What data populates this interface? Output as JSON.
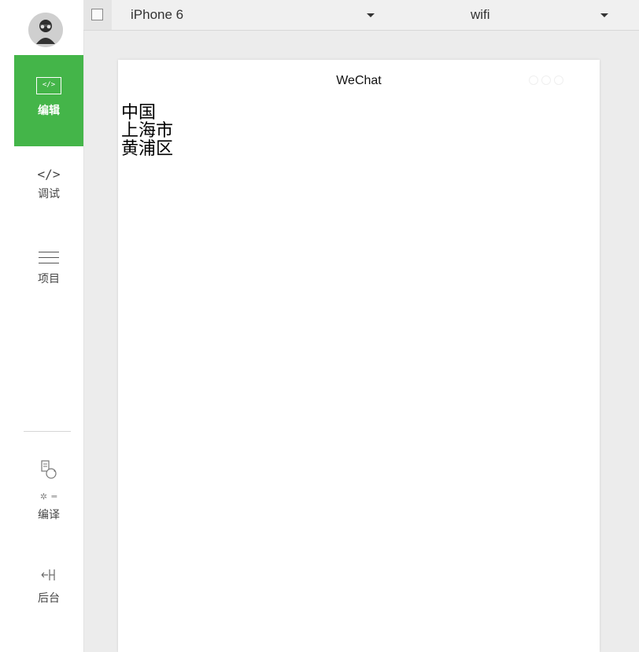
{
  "sidebar": {
    "items": [
      {
        "label": "编辑",
        "icon": "code-icon",
        "active": true
      },
      {
        "label": "调试",
        "icon": "code-brackets-icon",
        "glyph": "</>"
      },
      {
        "label": "项目",
        "icon": "menu-icon"
      },
      {
        "label": "编译",
        "icon": "compile-icon"
      },
      {
        "label": "后台",
        "icon": "background-icon",
        "glyph": "←|·|"
      }
    ],
    "accent_color": "#44b549"
  },
  "toolbar": {
    "device": "iPhone 6",
    "network": "wifi"
  },
  "phone": {
    "nav_title": "WeChat",
    "lines": [
      "中国",
      "上海市",
      "黄浦区"
    ]
  }
}
